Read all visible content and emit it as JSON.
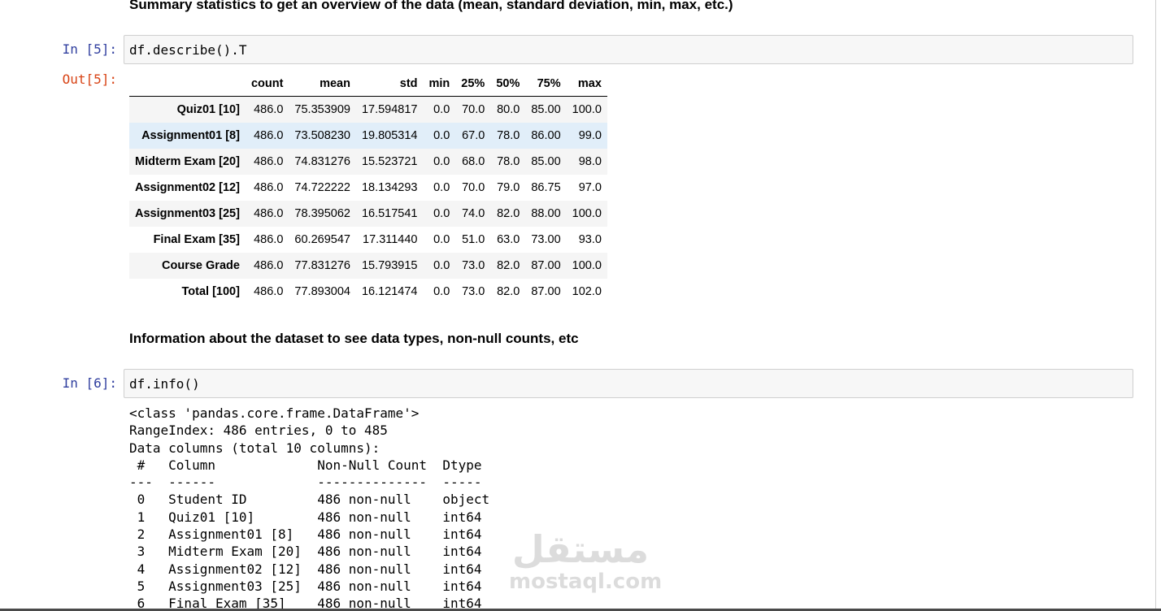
{
  "markdown": {
    "summary_heading": "Summary statistics to get an overview of the data (mean, standard deviation, min, max, etc.)",
    "info_heading": "Information about the dataset to see data types, non-null counts, etc"
  },
  "cell5": {
    "in_prompt": "In [5]:",
    "code": "df.describe().T",
    "out_prompt": "Out[5]:"
  },
  "describe_table": {
    "columns": [
      "count",
      "mean",
      "std",
      "min",
      "25%",
      "50%",
      "75%",
      "max"
    ],
    "rows": [
      {
        "label": "Quiz01 [10]",
        "values": [
          "486.0",
          "75.353909",
          "17.594817",
          "0.0",
          "70.0",
          "80.0",
          "85.00",
          "100.0"
        ]
      },
      {
        "label": "Assignment01 [8]",
        "values": [
          "486.0",
          "73.508230",
          "19.805314",
          "0.0",
          "67.0",
          "78.0",
          "86.00",
          "99.0"
        ]
      },
      {
        "label": "Midterm Exam [20]",
        "values": [
          "486.0",
          "74.831276",
          "15.523721",
          "0.0",
          "68.0",
          "78.0",
          "85.00",
          "98.0"
        ]
      },
      {
        "label": "Assignment02 [12]",
        "values": [
          "486.0",
          "74.722222",
          "18.134293",
          "0.0",
          "70.0",
          "79.0",
          "86.75",
          "97.0"
        ]
      },
      {
        "label": "Assignment03 [25]",
        "values": [
          "486.0",
          "78.395062",
          "16.517541",
          "0.0",
          "74.0",
          "82.0",
          "88.00",
          "100.0"
        ]
      },
      {
        "label": "Final Exam [35]",
        "values": [
          "486.0",
          "60.269547",
          "17.311440",
          "0.0",
          "51.0",
          "63.0",
          "73.00",
          "93.0"
        ]
      },
      {
        "label": "Course Grade",
        "values": [
          "486.0",
          "77.831276",
          "15.793915",
          "0.0",
          "73.0",
          "82.0",
          "87.00",
          "100.0"
        ]
      },
      {
        "label": "Total [100]",
        "values": [
          "486.0",
          "77.893004",
          "16.121474",
          "0.0",
          "73.0",
          "82.0",
          "87.00",
          "102.0"
        ]
      }
    ]
  },
  "cell6": {
    "in_prompt": "In [6]:",
    "code": "df.info()",
    "output": "<class 'pandas.core.frame.DataFrame'>\nRangeIndex: 486 entries, 0 to 485\nData columns (total 10 columns):\n #   Column             Non-Null Count  Dtype \n---  ------             --------------  ----- \n 0   Student ID         486 non-null    object\n 1   Quiz01 [10]        486 non-null    int64 \n 2   Assignment01 [8]   486 non-null    int64 \n 3   Midterm Exam [20]  486 non-null    int64 \n 4   Assignment02 [12]  486 non-null    int64 \n 5   Assignment03 [25]  486 non-null    int64 \n 6   Final Exam [35]    486 non-null    int64 "
  },
  "watermark": {
    "arabic": "مستقل",
    "latin": "mostaql.com"
  },
  "colors": {
    "in_prompt": "#303f9f",
    "out_prompt": "#d84315",
    "cell_background": "#f7f7f7",
    "cell_border": "#cfcfcf",
    "row_hover": "#e1eef9",
    "row_stripe": "#f5f5f5"
  }
}
